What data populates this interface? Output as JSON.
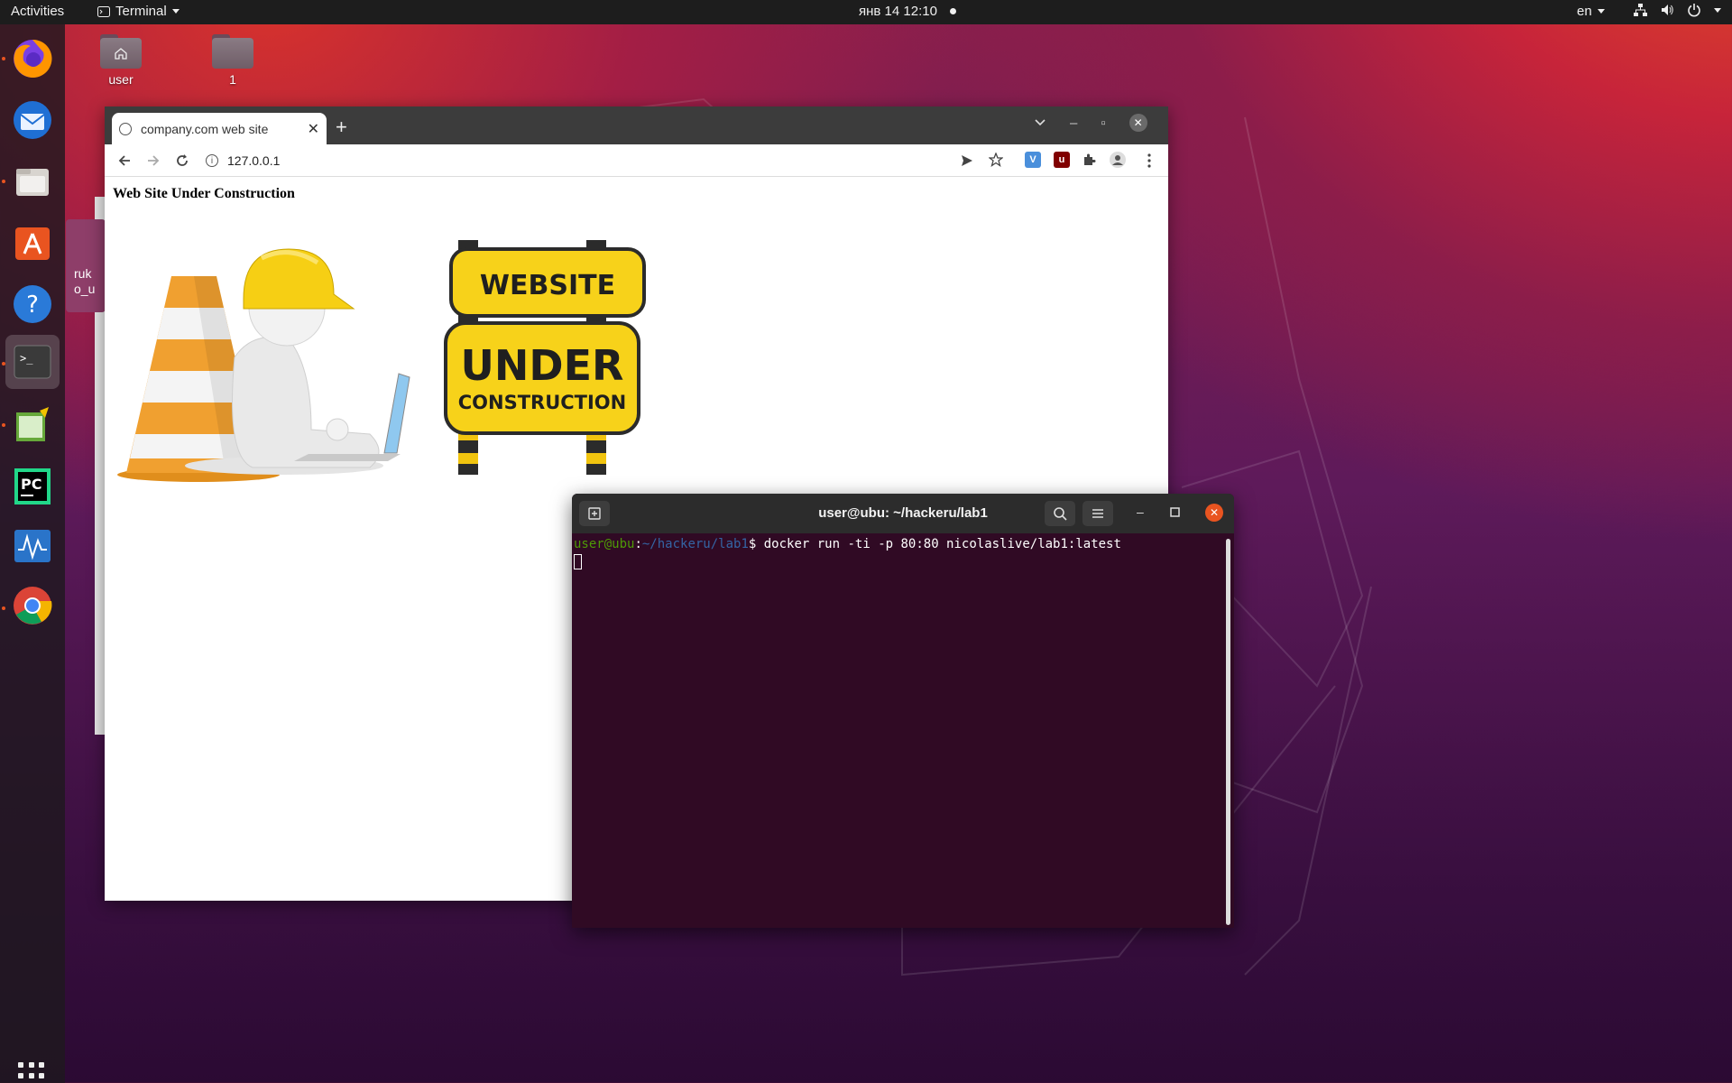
{
  "topbar": {
    "activities": "Activities",
    "app_name": "Terminal",
    "clock": "янв 14  12:10",
    "lang": "en"
  },
  "dock": {
    "items": [
      "firefox-icon",
      "thunderbird-icon",
      "files-icon",
      "software-icon",
      "help-icon",
      "terminal-icon",
      "text-editor-icon",
      "pycharm-icon",
      "system-monitor-icon",
      "chrome-icon"
    ]
  },
  "desktop": {
    "icons": [
      {
        "label": "user"
      },
      {
        "label": "1"
      }
    ],
    "hidden_window_text": "ruk\no_u"
  },
  "browser": {
    "tab_title": "company.com web site",
    "url": "127.0.0.1",
    "page_heading": "Web Site Under Construction",
    "sign_line1": "WEBSITE",
    "sign_line2": "UNDER",
    "sign_line3": "CONSTRUCTION"
  },
  "terminal": {
    "title": "user@ubu: ~/hackeru/lab1",
    "prompt_user": "user@ubu",
    "prompt_path": "~/hackeru/lab1",
    "prompt_symbol": "$",
    "command": " docker run -ti -p 80:80 nicolaslive/lab1:latest"
  },
  "colors": {
    "ubuntu_orange": "#e95420",
    "terminal_bg": "#300a24",
    "prompt_green": "#4e9a06",
    "prompt_blue": "#3465a4"
  }
}
